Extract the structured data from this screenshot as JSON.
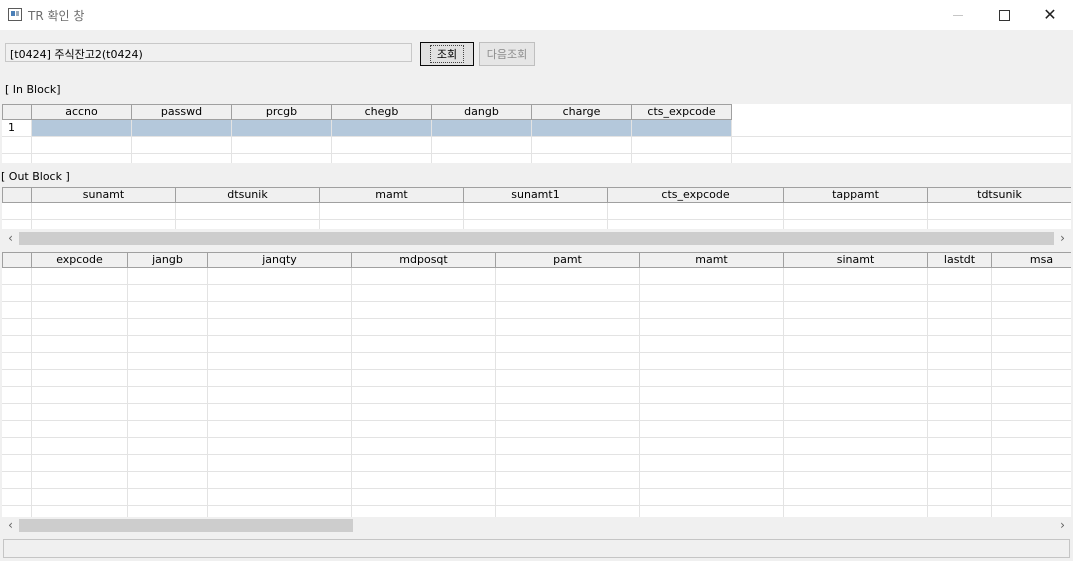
{
  "window": {
    "title": "TR 확인 창"
  },
  "toolbar": {
    "tr_name": "[t0424] 주식잔고2(t0424)",
    "query_label": "조회",
    "next_query_label": "다음조회"
  },
  "in_block": {
    "label": "[ In Block]",
    "columns": [
      "accno",
      "passwd",
      "prcgb",
      "chegb",
      "dangb",
      "charge",
      "cts_expcode"
    ],
    "row_number": "1"
  },
  "out_block": {
    "label": "[ Out Block ]",
    "columns": [
      "sunamt",
      "dtsunik",
      "mamt",
      "sunamt1",
      "cts_expcode",
      "tappamt",
      "tdtsunik"
    ]
  },
  "out_block1": {
    "columns": [
      "expcode",
      "jangb",
      "janqty",
      "mdposqt",
      "pamt",
      "mamt",
      "sinamt",
      "lastdt",
      "msa"
    ]
  },
  "colors": {
    "selected_row": "#b4c8db",
    "header_bg": "#f0f0f0"
  }
}
